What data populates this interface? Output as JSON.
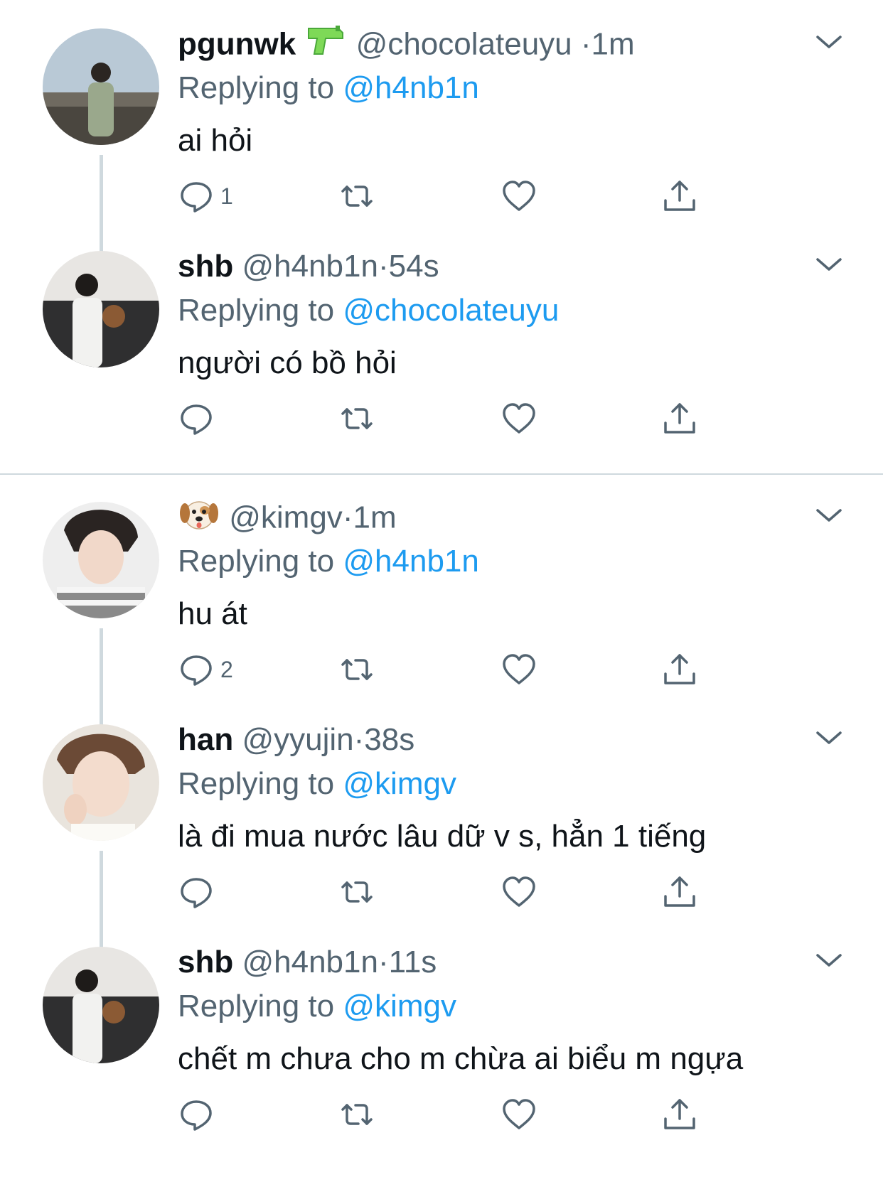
{
  "tweets": [
    {
      "name": "pgunwk",
      "name_emoji": "water-pistol-icon",
      "handle": "@chocolateuyu",
      "sep": "·",
      "time": "1m",
      "replying_prefix": "Replying to",
      "replying_to": "@h4nb1n",
      "text": "ai hỏi",
      "reply_count": "1"
    },
    {
      "name": "shb",
      "handle": "@h4nb1n",
      "sep": "·",
      "time": "54s",
      "replying_prefix": "Replying to",
      "replying_to": "@chocolateuyu",
      "text": "người có bồ hỏi",
      "reply_count": ""
    },
    {
      "name": "",
      "name_emoji": "dog-face-icon",
      "handle": "@kimgv",
      "sep": "·",
      "time": "1m",
      "replying_prefix": "Replying to",
      "replying_to": "@h4nb1n",
      "text": "hu át",
      "reply_count": "2"
    },
    {
      "name": "han",
      "handle": "@yyujin",
      "sep": "·",
      "time": "38s",
      "replying_prefix": "Replying to",
      "replying_to": "@kimgv",
      "text": "là đi mua nước lâu dữ v s, hẳn 1 tiếng",
      "reply_count": ""
    },
    {
      "name": "shb",
      "handle": "@h4nb1n",
      "sep": "·",
      "time": "11s",
      "replying_prefix": "Replying to",
      "replying_to": "@kimgv",
      "text": "chết m chưa cho m chừa ai biểu m ngựa",
      "reply_count": ""
    }
  ],
  "colors": {
    "text": "#0f1419",
    "secondary": "#536471",
    "mention": "#1d9bf0",
    "line": "#cfd9de"
  }
}
